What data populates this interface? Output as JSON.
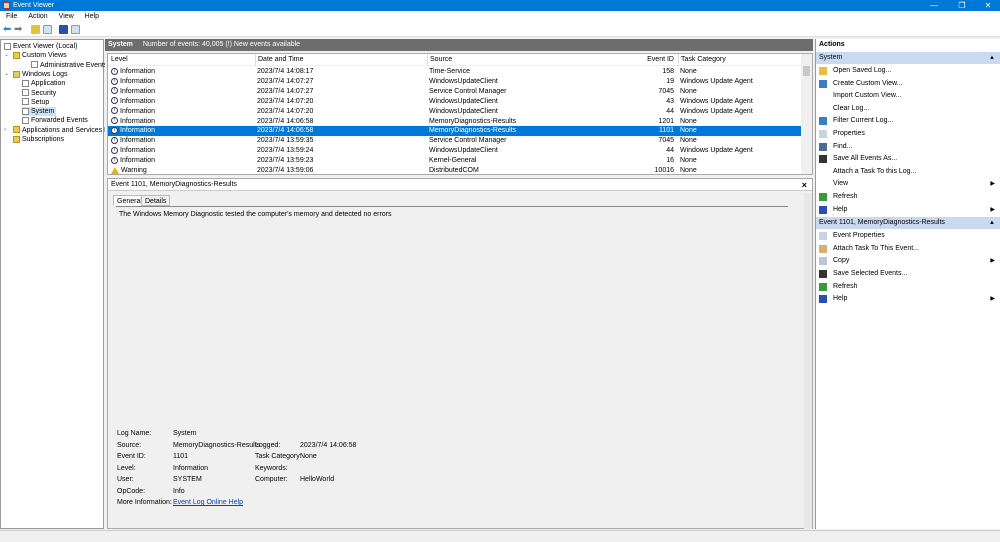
{
  "window": {
    "title": "Event Viewer",
    "min": "—",
    "max": "❐",
    "close": "✕"
  },
  "menu": [
    "File",
    "Action",
    "View",
    "Help"
  ],
  "tree": [
    {
      "label": "Event Viewer (Local)",
      "indent": 0,
      "exp": ""
    },
    {
      "label": "Custom Views",
      "indent": 1,
      "exp": "v"
    },
    {
      "label": "Administrative Events",
      "indent": 3,
      "exp": ""
    },
    {
      "label": "Windows Logs",
      "indent": 1,
      "exp": "v"
    },
    {
      "label": "Application",
      "indent": 2,
      "exp": ""
    },
    {
      "label": "Security",
      "indent": 2,
      "exp": ""
    },
    {
      "label": "Setup",
      "indent": 2,
      "exp": ""
    },
    {
      "label": "System",
      "indent": 2,
      "exp": "",
      "selected": true
    },
    {
      "label": "Forwarded Events",
      "indent": 2,
      "exp": ""
    },
    {
      "label": "Applications and Services Lo",
      "indent": 1,
      "exp": ">"
    },
    {
      "label": "Subscriptions",
      "indent": 1,
      "exp": ""
    }
  ],
  "center": {
    "log": "System",
    "summary": "Number of events: 40,005 (!) New events available"
  },
  "columns": {
    "level": "Level",
    "date": "Date and Time",
    "source": "Source",
    "id": "Event ID",
    "cat": "Task Category"
  },
  "events": [
    {
      "level": "Information",
      "date": "2023/7/4 14:08:17",
      "source": "Time-Service",
      "id": "158",
      "cat": "None"
    },
    {
      "level": "Information",
      "date": "2023/7/4 14:07:27",
      "source": "WindowsUpdateClient",
      "id": "19",
      "cat": "Windows Update Agent"
    },
    {
      "level": "Information",
      "date": "2023/7/4 14:07:27",
      "source": "Service Control Manager",
      "id": "7045",
      "cat": "None"
    },
    {
      "level": "Information",
      "date": "2023/7/4 14:07:20",
      "source": "WindowsUpdateClient",
      "id": "43",
      "cat": "Windows Update Agent"
    },
    {
      "level": "Information",
      "date": "2023/7/4 14:07:20",
      "source": "WindowsUpdateClient",
      "id": "44",
      "cat": "Windows Update Agent"
    },
    {
      "level": "Information",
      "date": "2023/7/4 14:06:58",
      "source": "MemoryDiagnostics-Results",
      "id": "1201",
      "cat": "None"
    },
    {
      "level": "Information",
      "date": "2023/7/4 14:06:58",
      "source": "MemoryDiagnostics-Results",
      "id": "1101",
      "cat": "None",
      "selected": true
    },
    {
      "level": "Information",
      "date": "2023/7/4 13:59:35",
      "source": "Service Control Manager",
      "id": "7045",
      "cat": "None"
    },
    {
      "level": "Information",
      "date": "2023/7/4 13:59:24",
      "source": "WindowsUpdateClient",
      "id": "44",
      "cat": "Windows Update Agent"
    },
    {
      "level": "Information",
      "date": "2023/7/4 13:59:23",
      "source": "Kernel-General",
      "id": "16",
      "cat": "None"
    },
    {
      "level": "Warning",
      "date": "2023/7/4 13:59:06",
      "source": "DistributedCOM",
      "id": "10016",
      "cat": "None"
    }
  ],
  "detail": {
    "title": "Event 1101, MemoryDiagnostics-Results",
    "close": "×",
    "tabs": [
      "General",
      "Details"
    ],
    "message": "The Windows Memory Diagnostic tested the computer's memory and detected no errors",
    "props": {
      "log_name_l": "Log Name:",
      "log_name": "System",
      "source_l": "Source:",
      "source": "MemoryDiagnostics-Results",
      "logged_l": "Logged:",
      "logged": "2023/7/4 14:06:58",
      "id_l": "Event ID:",
      "id": "1101",
      "cat_l": "Task Category:",
      "cat": "None",
      "level_l": "Level:",
      "level": "Information",
      "kw_l": "Keywords:",
      "user_l": "User:",
      "user": "SYSTEM",
      "comp_l": "Computer:",
      "comp": "HelloWorld",
      "op_l": "OpCode:",
      "op": "Info",
      "more_l": "More Information:",
      "more": "Event Log Online Help"
    }
  },
  "actions": {
    "title": "Actions",
    "sections": [
      {
        "header": "System",
        "items": [
          {
            "label": "Open Saved Log...",
            "icon": "folder"
          },
          {
            "label": "Create Custom View...",
            "icon": "filter"
          },
          {
            "label": "Import Custom View...",
            "icon": ""
          },
          {
            "label": "Clear Log...",
            "icon": ""
          },
          {
            "label": "Filter Current Log...",
            "icon": "filter"
          },
          {
            "label": "Properties",
            "icon": "properties"
          },
          {
            "label": "Find...",
            "icon": "find"
          },
          {
            "label": "Save All Events As...",
            "icon": "save"
          },
          {
            "label": "Attach a Task To this Log...",
            "icon": ""
          },
          {
            "label": "View",
            "icon": "",
            "sub": true
          },
          {
            "label": "Refresh",
            "icon": "refresh"
          },
          {
            "label": "Help",
            "icon": "help",
            "sub": true
          }
        ]
      },
      {
        "header": "Event 1101, MemoryDiagnostics-Results",
        "items": [
          {
            "label": "Event Properties",
            "icon": "properties"
          },
          {
            "label": "Attach Task To This Event...",
            "icon": "task"
          },
          {
            "label": "Copy",
            "icon": "copy",
            "sub": true
          },
          {
            "label": "Save Selected Events...",
            "icon": "save"
          },
          {
            "label": "Refresh",
            "icon": "refresh"
          },
          {
            "label": "Help",
            "icon": "help",
            "sub": true
          }
        ]
      }
    ]
  }
}
